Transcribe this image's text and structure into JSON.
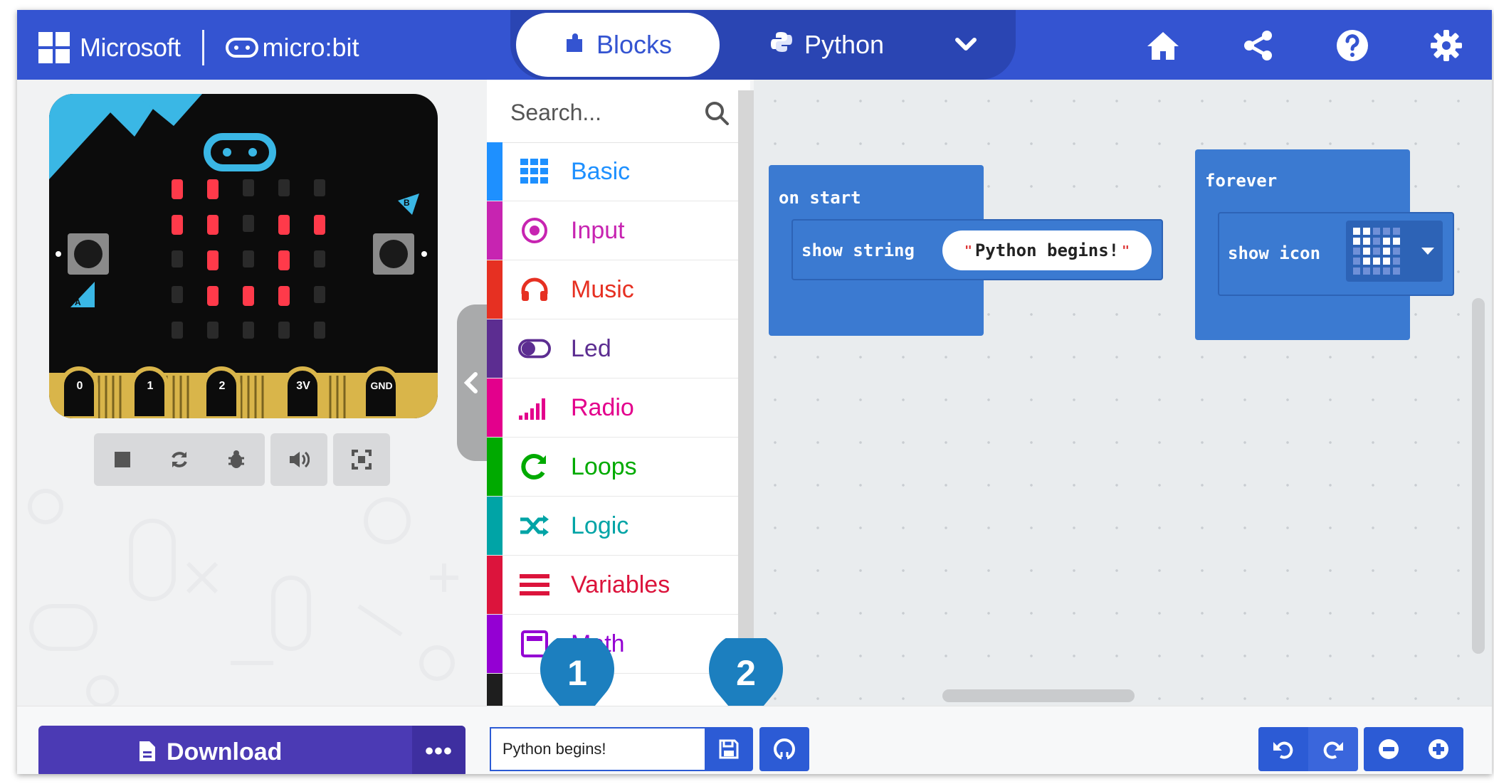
{
  "header": {
    "brand_microsoft": "Microsoft",
    "brand_microbit": "micro:bit",
    "tab_blocks": "Blocks",
    "tab_python": "Python",
    "icons": [
      "home-icon",
      "share-icon",
      "help-icon",
      "settings-icon"
    ]
  },
  "simulator": {
    "pins": [
      "0",
      "1",
      "2",
      "3V",
      "GND"
    ],
    "button_a": "A",
    "button_b": "B",
    "controls": [
      "stop-icon",
      "restart-icon",
      "debug-icon",
      "mute-icon",
      "fullscreen-icon"
    ]
  },
  "toolbox": {
    "search_placeholder": "Search...",
    "categories": [
      {
        "label": "Basic",
        "color": "#1e90ff",
        "icon": "grid-icon"
      },
      {
        "label": "Input",
        "color": "#c724b1",
        "icon": "target-icon"
      },
      {
        "label": "Music",
        "color": "#e63022",
        "icon": "headphones-icon"
      },
      {
        "label": "Led",
        "color": "#5c2d91",
        "icon": "toggle-icon"
      },
      {
        "label": "Radio",
        "color": "#e3008c",
        "icon": "signal-icon"
      },
      {
        "label": "Loops",
        "color": "#00aa00",
        "icon": "loop-icon"
      },
      {
        "label": "Logic",
        "color": "#00a4a6",
        "icon": "shuffle-icon"
      },
      {
        "label": "Variables",
        "color": "#dc143c",
        "icon": "lines-icon"
      },
      {
        "label": "Math",
        "color": "#9400d3",
        "icon": "calculator-icon"
      }
    ]
  },
  "workspace": {
    "on_start_label": "on start",
    "show_string_label": "show string",
    "show_string_value": "Python begins!",
    "forever_label": "forever",
    "show_icon_label": "show icon"
  },
  "bottom": {
    "download_label": "Download",
    "more_label": "•••",
    "project_name": "Python begins!"
  },
  "markers": [
    "1",
    "2"
  ]
}
